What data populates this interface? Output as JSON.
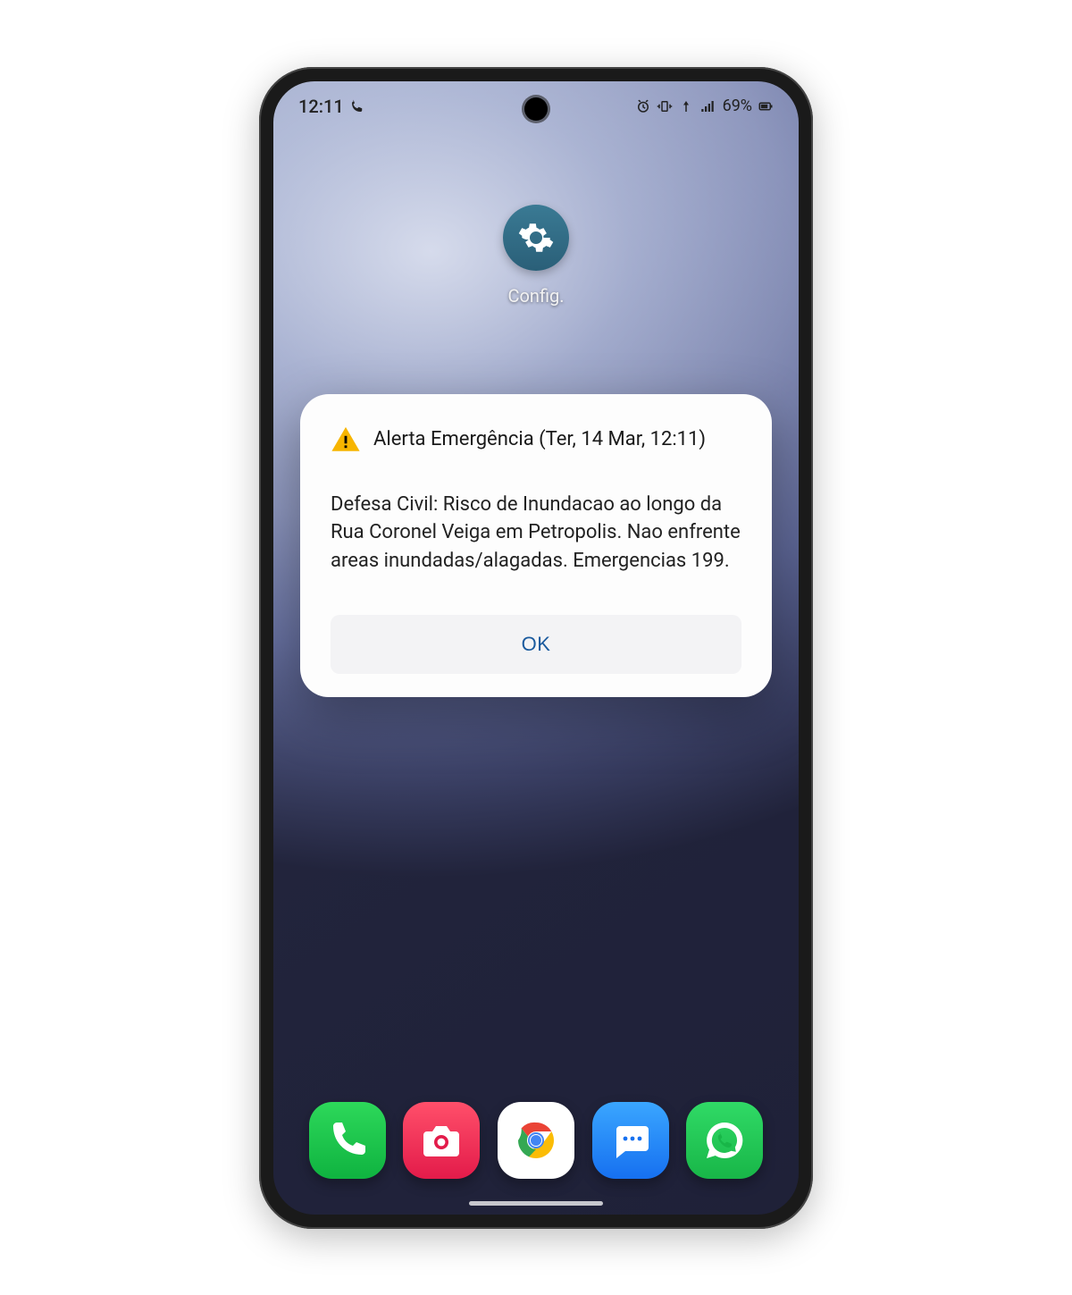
{
  "status_bar": {
    "time": "12:11",
    "battery": "69%",
    "icons": {
      "phone": "phone-status-icon",
      "alarm": "alarm-icon",
      "vibrate": "vibrate-icon",
      "network": "network-icon",
      "signal": "signal-icon",
      "battery": "battery-icon"
    }
  },
  "home": {
    "settings_app_label": "Config."
  },
  "dialog": {
    "title": "Alerta Emergência (Ter, 14 Mar, 12:11)",
    "body": "Defesa Civil: Risco de Inundacao ao longo da Rua Coronel Veiga em Petropolis. Nao enfrente areas inundadas/alagadas. Emergencias 199.",
    "ok_label": "OK"
  },
  "dock": {
    "apps": [
      {
        "name": "phone-app",
        "label": "Phone"
      },
      {
        "name": "camera-app",
        "label": "Camera"
      },
      {
        "name": "chrome-app",
        "label": "Chrome"
      },
      {
        "name": "messages-app",
        "label": "Messages"
      },
      {
        "name": "whatsapp-app",
        "label": "WhatsApp"
      }
    ]
  }
}
